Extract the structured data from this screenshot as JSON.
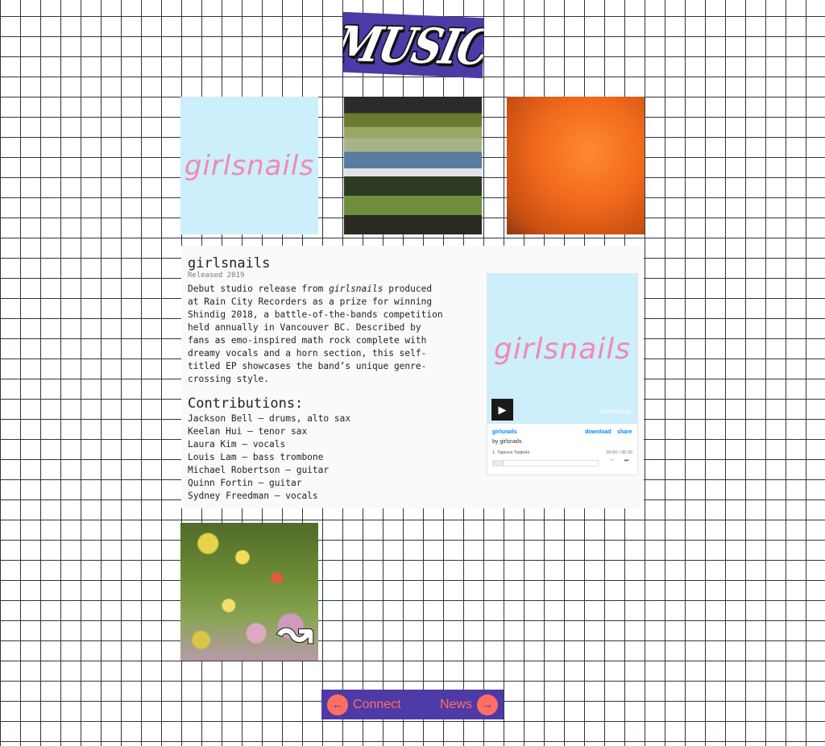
{
  "header": {
    "logo_text": "MUSIC",
    "logo_color": "#4d3aa6"
  },
  "tiles": {
    "album1_word": "girlsnails",
    "flowers_mark": "↝"
  },
  "album": {
    "title": "girlsnails",
    "released": "Released 2019",
    "desc_pre": "Debut studio release from ",
    "desc_em": "girlsnails",
    "desc_post": " produced at Rain City Recorders as a prize for winning Shindig 2018, a battle-of-the-bands competition held annually in Vancouver BC. Described by fans as emo-inspired math rock complete with dreamy vocals and a horn section, this self-titled EP showcases the band’s unique genre-crossing style.",
    "contributions_heading": "Contributions:",
    "contributions": [
      "Jackson Bell – drums, alto sax",
      "Keelan Hui – tenor sax",
      "Laura Kim – vocals",
      "Louis Lam – bass trombone",
      "Michael Robertson – guitar",
      "Quinn Fortin – guitar",
      "Sydney Freedman – vocals"
    ]
  },
  "player": {
    "art_word": "girlsnails",
    "brand": "bandcamp",
    "album_name": "girlsnails",
    "by": "by girlsnails",
    "download": "download",
    "share": "share",
    "track": "1.  Tapioca Tadpole",
    "time": "00:00 / 05:26",
    "play_icon": "play-icon",
    "accent": "#0687f5"
  },
  "nav": {
    "prev_label": "Connect",
    "next_label": "News",
    "accent": "#ff6f61"
  }
}
